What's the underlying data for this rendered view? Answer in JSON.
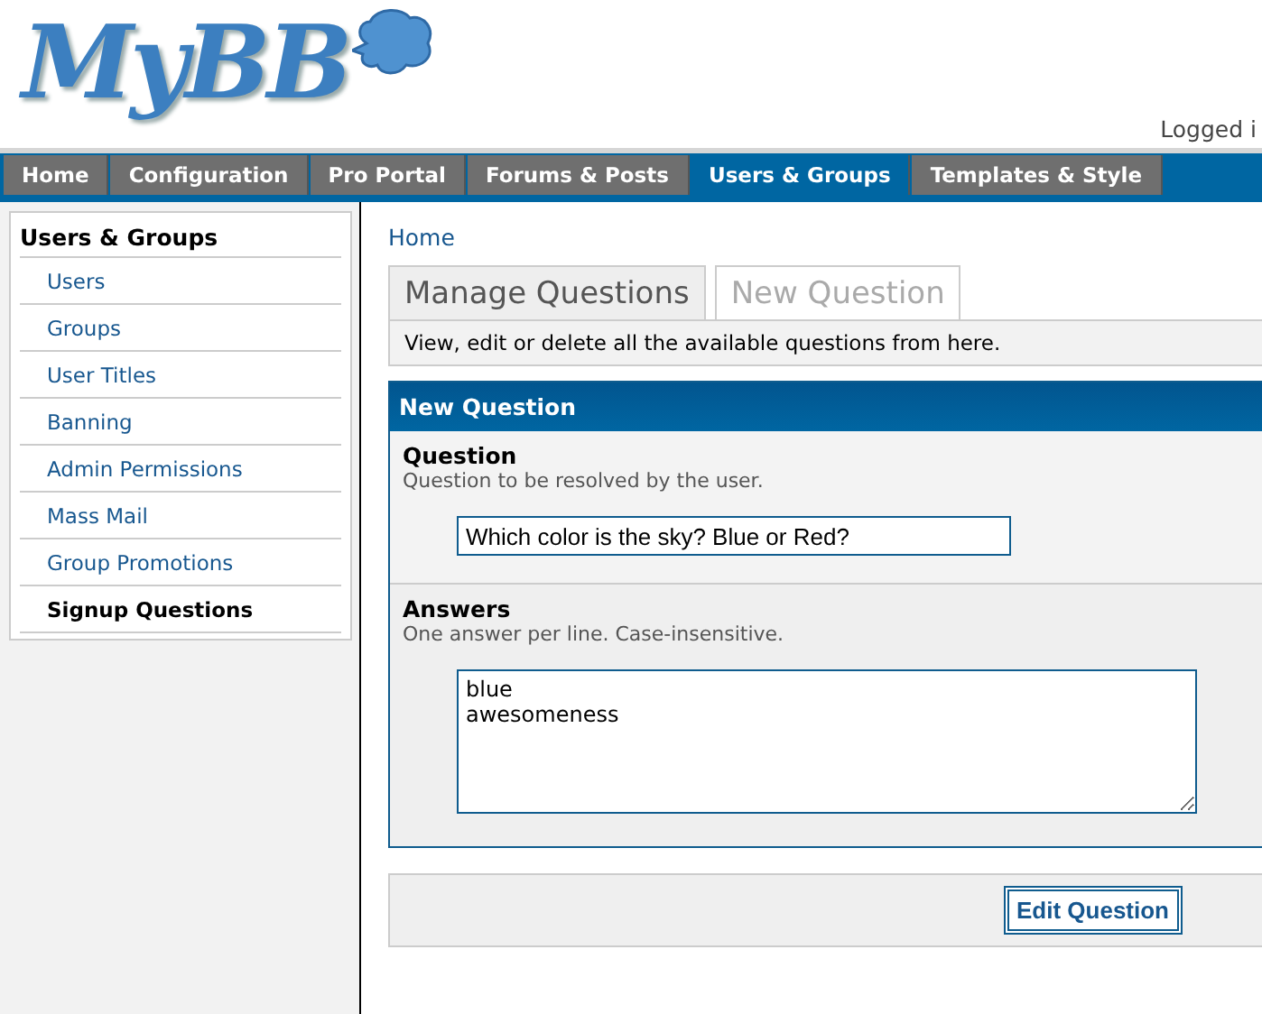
{
  "logo": {
    "text": "MyBB"
  },
  "header": {
    "login_text": "Logged i"
  },
  "nav": [
    {
      "label": "Home",
      "selected": false
    },
    {
      "label": "Configuration",
      "selected": false
    },
    {
      "label": "Pro Portal",
      "selected": false
    },
    {
      "label": "Forums & Posts",
      "selected": false
    },
    {
      "label": "Users & Groups",
      "selected": true
    },
    {
      "label": "Templates & Style",
      "selected": false
    }
  ],
  "sidebar": {
    "title": "Users & Groups",
    "items": [
      {
        "label": "Users",
        "selected": false
      },
      {
        "label": "Groups",
        "selected": false
      },
      {
        "label": "User Titles",
        "selected": false
      },
      {
        "label": "Banning",
        "selected": false
      },
      {
        "label": "Admin Permissions",
        "selected": false
      },
      {
        "label": "Mass Mail",
        "selected": false
      },
      {
        "label": "Group Promotions",
        "selected": false
      },
      {
        "label": "Signup Questions",
        "selected": true
      }
    ]
  },
  "breadcrumb": [
    "Home"
  ],
  "tabs": [
    {
      "label": "Manage Questions",
      "selected": true
    },
    {
      "label": "New Question",
      "selected": false
    }
  ],
  "tab_description": "View, edit or delete all the available questions from here.",
  "form": {
    "title": "New Question",
    "rows": [
      {
        "kind": "input",
        "label": "Question",
        "description": "Question to be resolved by the user.",
        "value": "Which color is the sky? Blue or Red?"
      },
      {
        "kind": "textarea",
        "label": "Answers",
        "description": "One answer per line. Case-insensitive.",
        "value": "blue\nawesomeness"
      }
    ]
  },
  "submit_button": "Edit Question"
}
